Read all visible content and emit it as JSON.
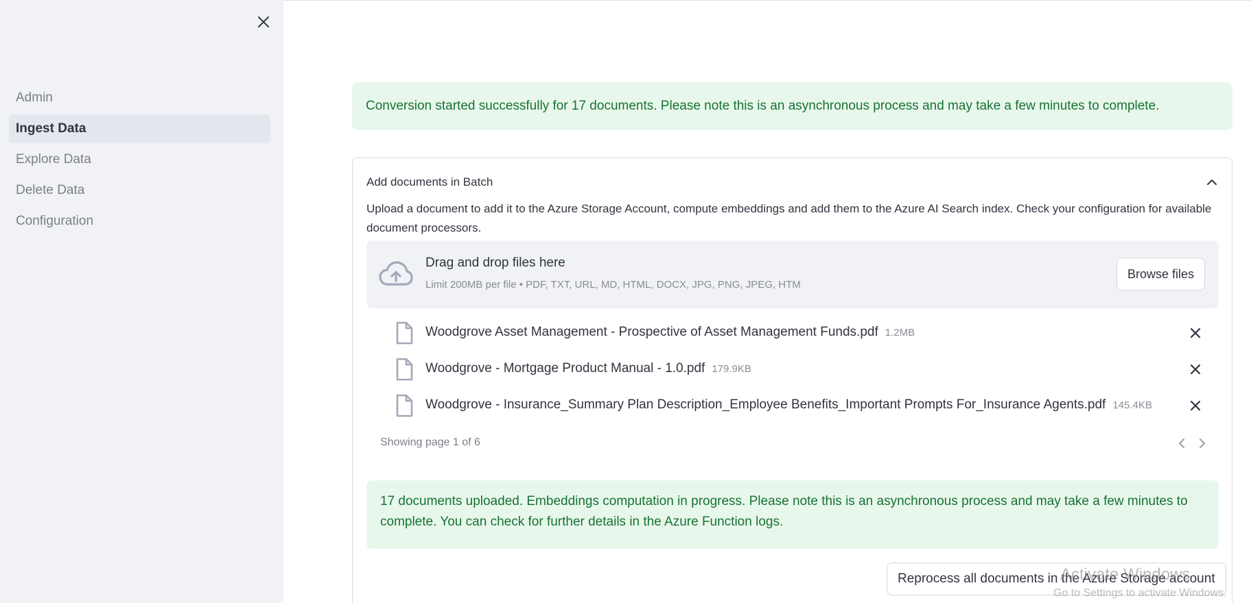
{
  "sidebar": {
    "close_icon": "close-icon",
    "items": [
      {
        "label": "Admin",
        "active": false
      },
      {
        "label": "Ingest Data",
        "active": true
      },
      {
        "label": "Explore Data",
        "active": false
      },
      {
        "label": "Delete Data",
        "active": false
      },
      {
        "label": "Configuration",
        "active": false
      }
    ]
  },
  "main": {
    "conversion_alert": "Conversion started successfully for 17 documents. Please note this is an asynchronous process and may take a few minutes to complete.",
    "expander": {
      "title": "Add documents in Batch",
      "description": "Upload a document to add it to the Azure Storage Account, compute embeddings and add them to the Azure AI Search index. Check your configuration for available document processors.",
      "uploader": {
        "title": "Drag and drop files here",
        "limit": "Limit 200MB per file • PDF, TXT, URL, MD, HTML, DOCX, JPG, PNG, JPEG, HTM",
        "browse_label": "Browse files"
      },
      "files": [
        {
          "name": "Woodgrove Asset Management - Prospective of Asset Management Funds.pdf",
          "size": "1.2MB"
        },
        {
          "name": "Woodgrove - Mortgage Product Manual - 1.0.pdf",
          "size": "179.9KB"
        },
        {
          "name": "Woodgrove - Insurance_Summary Plan Description_Employee Benefits_Important Prompts For_Insurance Agents.pdf",
          "size": "145.4KB"
        }
      ],
      "pagination": "Showing page 1 of 6",
      "upload_alert": "17 documents uploaded. Embeddings computation in progress. Please note this is an asynchronous process and may take a few minutes to complete. You can check for further details in the Azure Function logs.",
      "reprocess_label": "Reprocess all documents in the Azure Storage account"
    }
  },
  "watermark": {
    "title": "Activate Windows",
    "subtitle": "Go to Settings to activate Windows."
  },
  "colors": {
    "sidebar_bg": "#f0f2f6",
    "success_bg": "#e8f7ec",
    "success_text": "#177233",
    "text": "#31333f",
    "muted": "#8a8c94"
  }
}
